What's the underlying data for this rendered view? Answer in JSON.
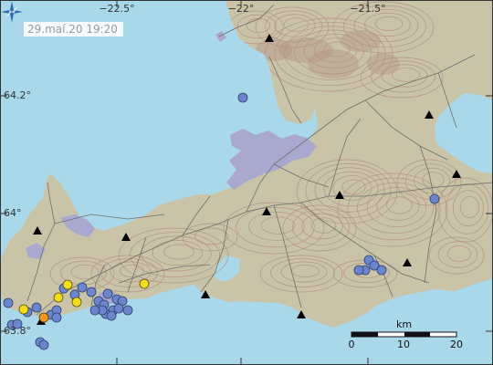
{
  "timestamp": "29.maí.20  19:20",
  "lon_labels": [
    "−22.5°",
    "−22°",
    "−21.5°"
  ],
  "lat_labels": [
    "64.2°",
    "64°",
    "63.8°"
  ],
  "scale": {
    "unit": "km",
    "ticks": [
      "0",
      "10",
      "20"
    ]
  },
  "colors": {
    "sea": "#a9d8eb",
    "land": "#c9c3a8",
    "urban": "#a9a9cf",
    "contour": "#b49484",
    "roads": "#6f6f6f",
    "blue_quake": "#6b86cc",
    "yellow_quake": "#f3dd1f",
    "orange_quake": "#f59a1c"
  },
  "icons": {
    "logo": "imo-star-logo-icon",
    "station": "seismic-station-triangle-icon"
  },
  "stations_count": 11,
  "earthquakes": {
    "blue_count": 33,
    "yellow_count": 5,
    "orange_count": 1
  }
}
